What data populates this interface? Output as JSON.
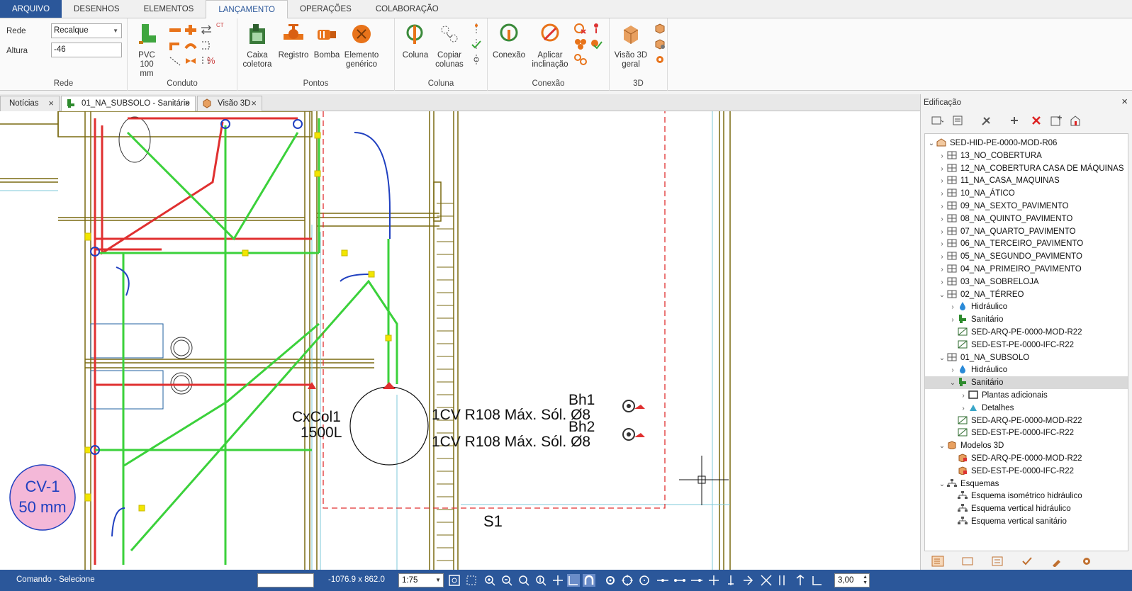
{
  "ribbon_tabs": [
    "ARQUIVO",
    "DESENHOS",
    "ELEMENTOS",
    "LANÇAMENTO",
    "OPERAÇÕES",
    "COLABORAÇÃO"
  ],
  "rede": {
    "rede_label": "Rede",
    "rede_value": "Recalque",
    "altura_label": "Altura",
    "altura_value": "-46",
    "group_label": "Rede"
  },
  "conduto": {
    "pvc_label_1": "PVC 100",
    "pvc_label_2": "mm",
    "small_text_ct": "CT",
    "small_text_pct": "%",
    "group_label": "Conduto"
  },
  "pontos": {
    "caixa_1": "Caixa",
    "caixa_2": "coletora",
    "registro": "Registro",
    "bomba": "Bomba",
    "elemento_1": "Elemento",
    "elemento_2": "genérico",
    "group_label": "Pontos"
  },
  "coluna": {
    "coluna": "Coluna",
    "copiar_1": "Copiar",
    "copiar_2": "colunas",
    "group_label": "Coluna"
  },
  "conexao": {
    "conexao": "Conexão",
    "aplicar_1": "Aplicar",
    "aplicar_2": "inclinação",
    "group_label": "Conexão"
  },
  "visao3d": {
    "visao_1": "Visão 3D",
    "visao_2": "geral",
    "group_label": "3D"
  },
  "doc_tabs": [
    "Notícias",
    "01_NA_SUBSOLO - Sanitário",
    "Visão 3D"
  ],
  "drawing_labels": {
    "cxcol_1": "CxCol1",
    "cxcol_2": "1500L",
    "bh1": "Bh1",
    "bh2": "Bh2",
    "cv_line_1": "1CV R108 Máx. Sól. Ø8",
    "cv_line_2": "1CV R108 Máx. Sól. Ø8",
    "s1": "S1",
    "cv_circle_1": "CV-1",
    "cv_circle_2": "50 mm"
  },
  "panel": {
    "title": "Edificação",
    "tree": [
      {
        "label": "SED-HID-PE-0000-MOD-R06",
        "icon": "building-icon",
        "level": 0,
        "toggle": "expanded"
      },
      {
        "label": "13_NO_COBERTURA",
        "icon": "floor-icon",
        "level": 1,
        "toggle": "collapsed"
      },
      {
        "label": "12_NA_COBERTURA CASA DE MÁQUINAS",
        "icon": "floor-icon",
        "level": 1,
        "toggle": "collapsed"
      },
      {
        "label": "11_NA_CASA_MAQUINAS",
        "icon": "floor-icon",
        "level": 1,
        "toggle": "collapsed"
      },
      {
        "label": "10_NA_ÁTICO",
        "icon": "floor-icon",
        "level": 1,
        "toggle": "collapsed"
      },
      {
        "label": "09_NA_SEXTO_PAVIMENTO",
        "icon": "floor-icon",
        "level": 1,
        "toggle": "collapsed"
      },
      {
        "label": "08_NA_QUINTO_PAVIMENTO",
        "icon": "floor-icon",
        "level": 1,
        "toggle": "collapsed"
      },
      {
        "label": "07_NA_QUARTO_PAVIMENTO",
        "icon": "floor-icon",
        "level": 1,
        "toggle": "collapsed"
      },
      {
        "label": "06_NA_TERCEIRO_PAVIMENTO",
        "icon": "floor-icon",
        "level": 1,
        "toggle": "collapsed"
      },
      {
        "label": "05_NA_SEGUNDO_PAVIMENTO",
        "icon": "floor-icon",
        "level": 1,
        "toggle": "collapsed"
      },
      {
        "label": "04_NA_PRIMEIRO_PAVIMENTO",
        "icon": "floor-icon",
        "level": 1,
        "toggle": "collapsed"
      },
      {
        "label": "03_NA_SOBRELOJA",
        "icon": "floor-icon",
        "level": 1,
        "toggle": "collapsed"
      },
      {
        "label": "02_NA_TÉRREO",
        "icon": "floor-icon",
        "level": 1,
        "toggle": "expanded"
      },
      {
        "label": "Hidráulico",
        "icon": "water-drop-icon",
        "level": 2,
        "toggle": "collapsed"
      },
      {
        "label": "Sanitário",
        "icon": "toilet-icon",
        "level": 2,
        "toggle": "collapsed"
      },
      {
        "label": "SED-ARQ-PE-0000-MOD-R22",
        "icon": "plan-icon",
        "level": 2,
        "toggle": "none"
      },
      {
        "label": "SED-EST-PE-0000-IFC-R22",
        "icon": "plan-icon",
        "level": 2,
        "toggle": "none"
      },
      {
        "label": "01_NA_SUBSOLO",
        "icon": "floor-icon",
        "level": 1,
        "toggle": "expanded"
      },
      {
        "label": "Hidráulico",
        "icon": "water-drop-icon",
        "level": 2,
        "toggle": "collapsed"
      },
      {
        "label": "Sanitário",
        "icon": "toilet-icon",
        "level": 2,
        "toggle": "expanded",
        "selected": true
      },
      {
        "label": "Plantas adicionais",
        "icon": "sheet-icon",
        "level": 3,
        "toggle": "collapsed"
      },
      {
        "label": "Detalhes",
        "icon": "detail-icon",
        "level": 3,
        "toggle": "collapsed"
      },
      {
        "label": "SED-ARQ-PE-0000-MOD-R22",
        "icon": "plan-icon",
        "level": 2,
        "toggle": "none"
      },
      {
        "label": "SED-EST-PE-0000-IFC-R22",
        "icon": "plan-icon",
        "level": 2,
        "toggle": "none"
      },
      {
        "label": "Modelos 3D",
        "icon": "cube-icon",
        "level": 1,
        "toggle": "expanded"
      },
      {
        "label": "SED-ARQ-PE-0000-MOD-R22",
        "icon": "model-icon",
        "level": 2,
        "toggle": "none"
      },
      {
        "label": "SED-EST-PE-0000-IFC-R22",
        "icon": "model-icon",
        "level": 2,
        "toggle": "none"
      },
      {
        "label": "Esquemas",
        "icon": "schema-icon",
        "level": 1,
        "toggle": "expanded"
      },
      {
        "label": "Esquema isométrico hidráulico",
        "icon": "schema-icon",
        "level": 2,
        "toggle": "none"
      },
      {
        "label": "Esquema vertical hidráulico",
        "icon": "schema-icon",
        "level": 2,
        "toggle": "none"
      },
      {
        "label": "Esquema vertical sanitário",
        "icon": "schema-icon",
        "level": 2,
        "toggle": "none"
      }
    ]
  },
  "status": {
    "command": "Comando - Selecione",
    "coords": "-1076.9 x 862.0",
    "scale": "1:75",
    "step": "3,00"
  },
  "colors": {
    "ribbon_blue": "#2b579a",
    "pipe_green": "#3bd13b",
    "pipe_red": "#e03030",
    "pipe_blue": "#2040c0",
    "wall_olive": "#7a6a10",
    "marker_pink": "#f4b8d8"
  }
}
